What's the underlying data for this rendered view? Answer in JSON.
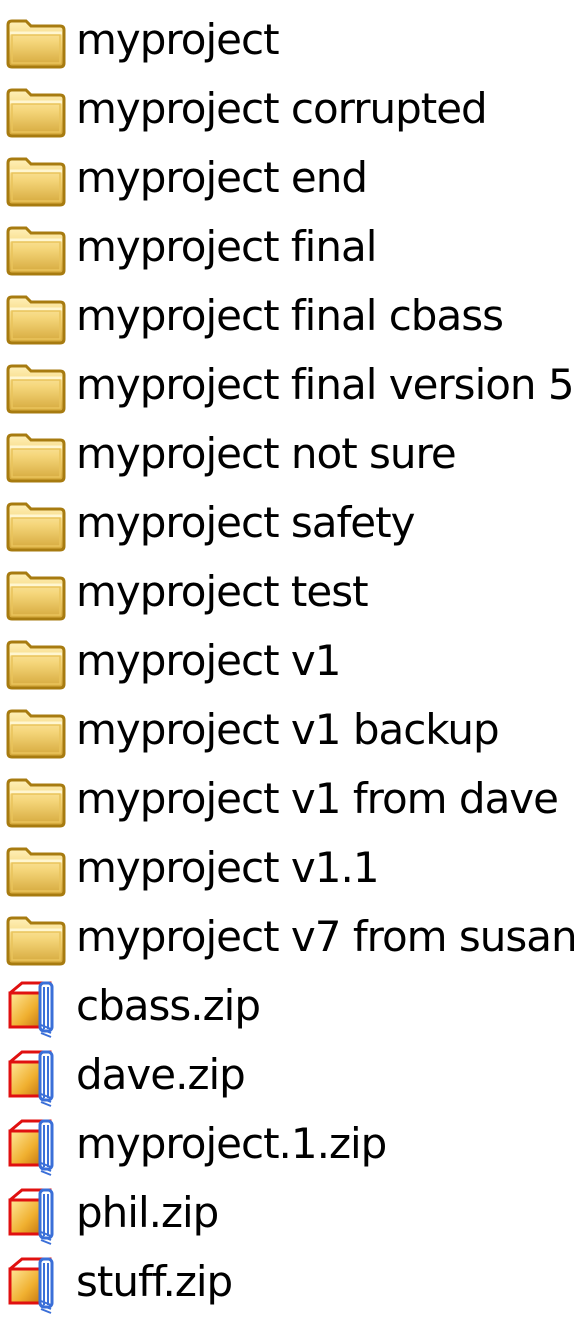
{
  "items": [
    {
      "type": "folder",
      "name": "myproject",
      "icon": "folder-icon"
    },
    {
      "type": "folder",
      "name": "myproject corrupted",
      "icon": "folder-icon"
    },
    {
      "type": "folder",
      "name": "myproject end",
      "icon": "folder-icon"
    },
    {
      "type": "folder",
      "name": "myproject final",
      "icon": "folder-icon"
    },
    {
      "type": "folder",
      "name": "myproject final cbass",
      "icon": "folder-icon"
    },
    {
      "type": "folder",
      "name": "myproject final version 5",
      "icon": "folder-icon"
    },
    {
      "type": "folder",
      "name": "myproject not sure",
      "icon": "folder-icon"
    },
    {
      "type": "folder",
      "name": "myproject safety",
      "icon": "folder-icon"
    },
    {
      "type": "folder",
      "name": "myproject test",
      "icon": "folder-icon"
    },
    {
      "type": "folder",
      "name": "myproject v1",
      "icon": "folder-icon"
    },
    {
      "type": "folder",
      "name": "myproject v1 backup",
      "icon": "folder-icon"
    },
    {
      "type": "folder",
      "name": "myproject v1 from dave",
      "icon": "folder-icon"
    },
    {
      "type": "folder",
      "name": "myproject v1.1",
      "icon": "folder-icon"
    },
    {
      "type": "folder",
      "name": "myproject v7 from susan",
      "icon": "folder-icon"
    },
    {
      "type": "zip",
      "name": "cbass.zip",
      "icon": "zip-folder-icon"
    },
    {
      "type": "zip",
      "name": "dave.zip",
      "icon": "zip-folder-icon"
    },
    {
      "type": "zip",
      "name": "myproject.1.zip",
      "icon": "zip-folder-icon"
    },
    {
      "type": "zip",
      "name": "phil.zip",
      "icon": "zip-folder-icon"
    },
    {
      "type": "zip",
      "name": "stuff.zip",
      "icon": "zip-folder-icon"
    }
  ],
  "colors": {
    "folder_fill": "#f5d67a",
    "folder_stroke": "#a77b10",
    "zip_red": "#e01010",
    "zip_blue": "#3a6fd8",
    "text": "#000000"
  }
}
